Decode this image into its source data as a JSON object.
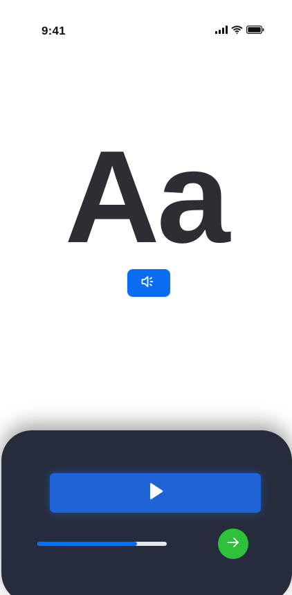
{
  "status_bar": {
    "time": "9:41",
    "icons": [
      "cellular-signal-icon",
      "wifi-icon",
      "battery-icon"
    ]
  },
  "card": {
    "glyph": "Aa",
    "speaker_icon": "speaker-icon"
  },
  "player": {
    "play_icon": "play-icon",
    "progress": 0.77,
    "next_icon": "arrow-right-icon"
  },
  "colors": {
    "accent_blue": "#0a6cf0",
    "play_blue": "#1f63d6",
    "panel_bg": "#272c3d",
    "next_green": "#2fc13b",
    "glyph_color": "#2d2d33"
  }
}
